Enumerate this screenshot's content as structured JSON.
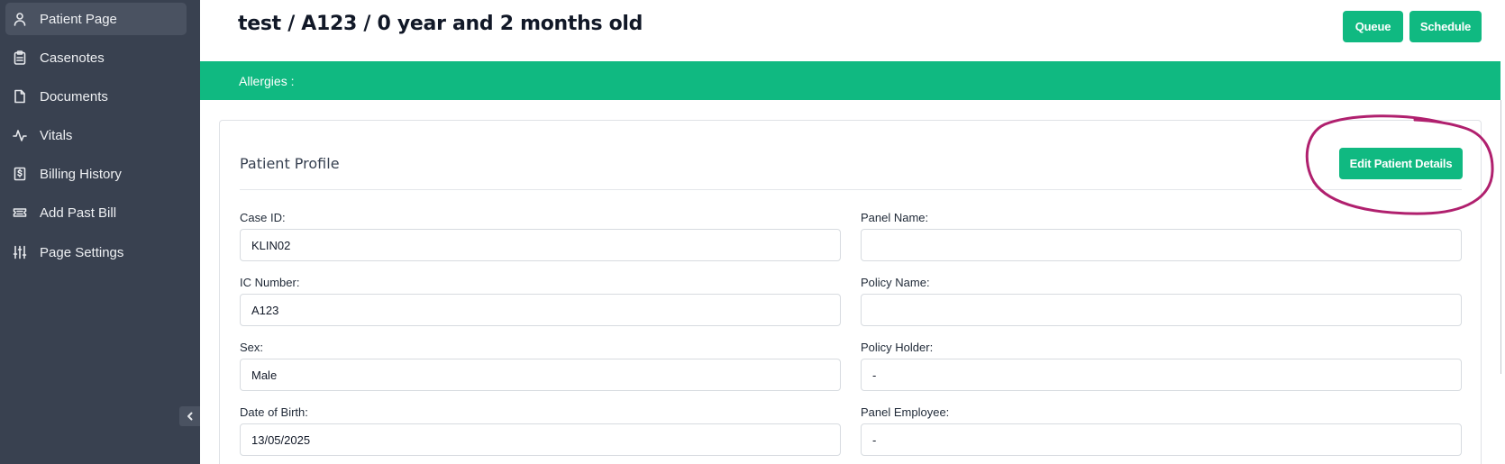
{
  "sidebar": {
    "items": [
      {
        "label": "Patient Page",
        "icon": "user-icon"
      },
      {
        "label": "Casenotes",
        "icon": "clipboard-icon"
      },
      {
        "label": "Documents",
        "icon": "document-icon"
      },
      {
        "label": "Vitals",
        "icon": "activity-icon"
      },
      {
        "label": "Billing History",
        "icon": "receipt-dollar-icon"
      },
      {
        "label": "Add Past Bill",
        "icon": "ticket-icon"
      },
      {
        "label": "Page Settings",
        "icon": "sliders-icon"
      }
    ],
    "collapse_icon": "chevron-left-icon"
  },
  "header": {
    "title": "test / A123 / 0 year and 2 months old",
    "queue_label": "Queue",
    "schedule_label": "Schedule"
  },
  "allergies": {
    "label": "Allergies :"
  },
  "profile": {
    "title": "Patient Profile",
    "edit_label": "Edit Patient Details",
    "left_fields": [
      {
        "label": "Case ID:",
        "value": "KLIN02"
      },
      {
        "label": "IC Number:",
        "value": "A123"
      },
      {
        "label": "Sex:",
        "value": "Male"
      },
      {
        "label": "Date of Birth:",
        "value": "13/05/2025"
      }
    ],
    "right_fields": [
      {
        "label": "Panel Name:",
        "value": ""
      },
      {
        "label": "Policy Name:",
        "value": ""
      },
      {
        "label": "Policy Holder:",
        "value": "-"
      },
      {
        "label": "Panel Employee:",
        "value": "-"
      }
    ]
  },
  "colors": {
    "sidebar_bg": "#394150",
    "accent": "#10b981",
    "annotation": "#b0206e"
  }
}
